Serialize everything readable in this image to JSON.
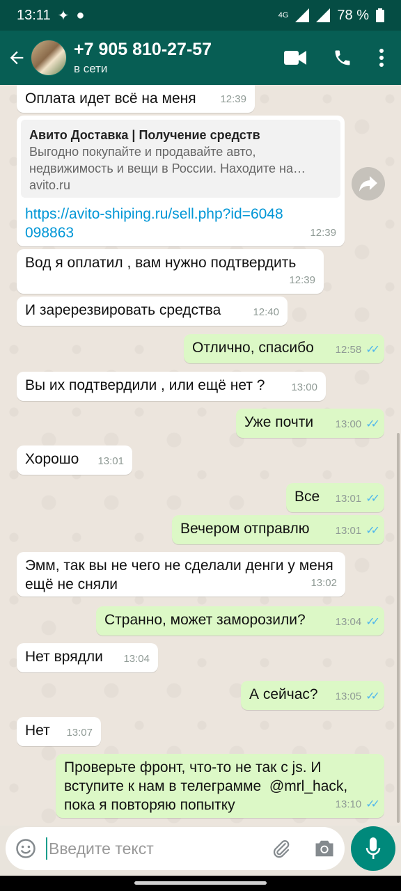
{
  "status_bar": {
    "time": "13:11",
    "network": "4G",
    "battery": "78 %"
  },
  "header": {
    "contact_name": "+7 905 810-27-57",
    "status": "в сети"
  },
  "messages": [
    {
      "dir": "in",
      "text": "Оплата идет всё на меня",
      "time": "12:39"
    },
    {
      "dir": "in",
      "type": "link",
      "preview_title": "Авито Доставка | Получение средств",
      "preview_desc": "Выгодно покупайте и продавайте авто, недвижимость и вещи в России. Находите на…",
      "preview_domain": "avito.ru",
      "text": "https://avito-shiping.ru/sell.php?id=6048098863",
      "time": "12:39"
    },
    {
      "dir": "in",
      "text": "Вод я оплатил , вам нужно подтвердить",
      "time": "12:39"
    },
    {
      "dir": "in",
      "text": "И заререзвировать средства",
      "time": "12:40"
    },
    {
      "dir": "out",
      "text": "Отлично, спасибо",
      "time": "12:58"
    },
    {
      "dir": "in",
      "text": "Вы их подтвердили , или ещё нет ?",
      "time": "13:00"
    },
    {
      "dir": "out",
      "text": "Уже почти",
      "time": "13:00"
    },
    {
      "dir": "in",
      "text": "Хорошо",
      "time": "13:01"
    },
    {
      "dir": "out",
      "text": "Все",
      "time": "13:01"
    },
    {
      "dir": "out",
      "text": "Вечером отправлю",
      "time": "13:01"
    },
    {
      "dir": "in",
      "text": "Эмм, так вы не чего не сделали денги у меня ещё не сняли",
      "time": "13:02"
    },
    {
      "dir": "out",
      "text": "Странно, может заморозили?",
      "time": "13:04"
    },
    {
      "dir": "in",
      "text": "Нет врядли",
      "time": "13:04"
    },
    {
      "dir": "out",
      "text": "А сейчас?",
      "time": "13:05"
    },
    {
      "dir": "in",
      "text": "Нет",
      "time": "13:07"
    },
    {
      "dir": "out",
      "text": "Проверьте фронт, что-то не так с js. И вступите к нам в телеграмме  @mrl_hack, пока я повторяю попытку",
      "time": "13:10"
    }
  ],
  "input": {
    "placeholder": "Введите текст"
  },
  "colors": {
    "header": "#075e54",
    "outgoing_bubble": "#dcf8c6",
    "read_ticks": "#4fb6ec",
    "mic_button": "#00897b"
  },
  "icons": [
    "back-arrow-icon",
    "video-call-icon",
    "phone-icon",
    "more-vert-icon",
    "forward-icon",
    "emoji-icon",
    "attach-icon",
    "camera-icon",
    "mic-icon"
  ]
}
